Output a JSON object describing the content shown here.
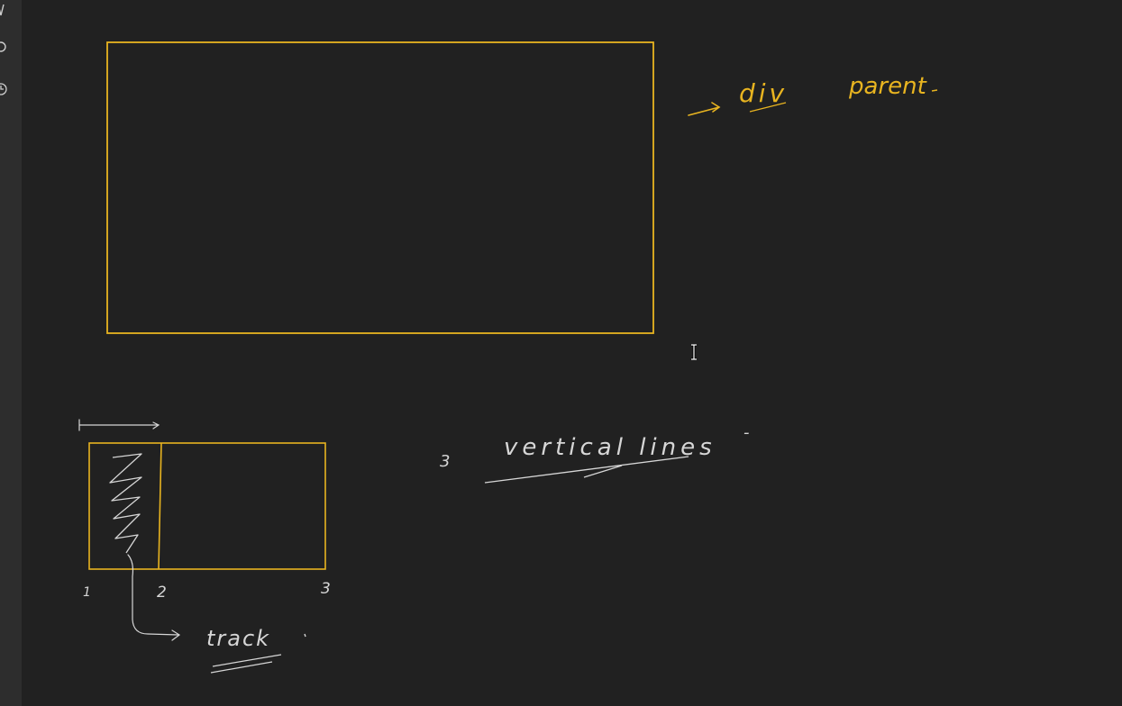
{
  "toolbar": {
    "tools": [
      {
        "icon": "pen-tool-icon"
      },
      {
        "icon": "circle-shape-icon"
      },
      {
        "icon": "history-clock-icon"
      }
    ]
  },
  "colors": {
    "background": "#212121",
    "toolbar": "#2d2d2d",
    "ink_yellow": "#e8b420",
    "ink_white": "#d6d6d6"
  },
  "annotations": {
    "div_label": "div",
    "parent_label": "parent",
    "vertical_lines_count": "3",
    "vertical_lines_label": "vertical lines",
    "dash": "-",
    "track_label": "track",
    "line_number_1": "1",
    "line_number_2": "2",
    "line_number_3": "3"
  }
}
